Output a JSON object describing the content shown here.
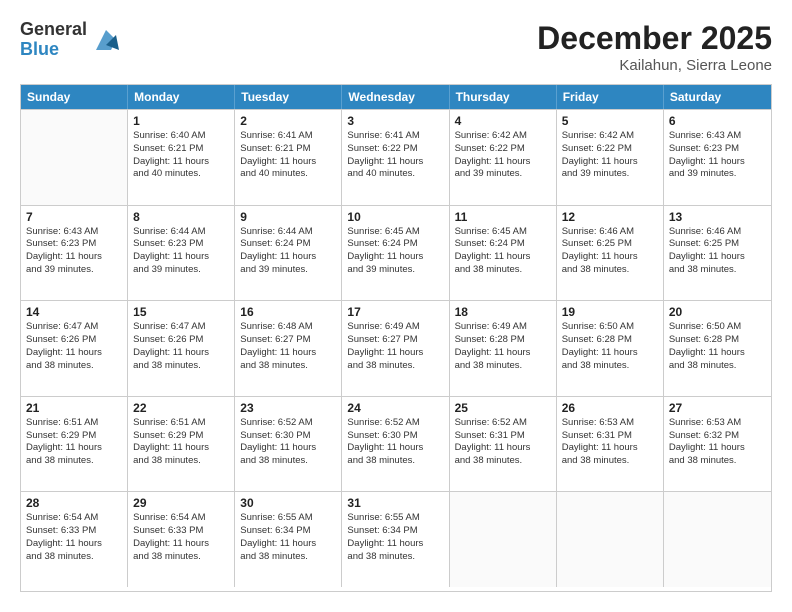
{
  "logo": {
    "general": "General",
    "blue": "Blue"
  },
  "title": "December 2025",
  "location": "Kailahun, Sierra Leone",
  "days_of_week": [
    "Sunday",
    "Monday",
    "Tuesday",
    "Wednesday",
    "Thursday",
    "Friday",
    "Saturday"
  ],
  "weeks": [
    [
      {
        "day": "",
        "sunrise": "",
        "sunset": "",
        "daylight": "",
        "empty": true
      },
      {
        "day": "1",
        "sunrise": "Sunrise: 6:40 AM",
        "sunset": "Sunset: 6:21 PM",
        "daylight": "Daylight: 11 hours and 40 minutes."
      },
      {
        "day": "2",
        "sunrise": "Sunrise: 6:41 AM",
        "sunset": "Sunset: 6:21 PM",
        "daylight": "Daylight: 11 hours and 40 minutes."
      },
      {
        "day": "3",
        "sunrise": "Sunrise: 6:41 AM",
        "sunset": "Sunset: 6:22 PM",
        "daylight": "Daylight: 11 hours and 40 minutes."
      },
      {
        "day": "4",
        "sunrise": "Sunrise: 6:42 AM",
        "sunset": "Sunset: 6:22 PM",
        "daylight": "Daylight: 11 hours and 39 minutes."
      },
      {
        "day": "5",
        "sunrise": "Sunrise: 6:42 AM",
        "sunset": "Sunset: 6:22 PM",
        "daylight": "Daylight: 11 hours and 39 minutes."
      },
      {
        "day": "6",
        "sunrise": "Sunrise: 6:43 AM",
        "sunset": "Sunset: 6:23 PM",
        "daylight": "Daylight: 11 hours and 39 minutes."
      }
    ],
    [
      {
        "day": "7",
        "sunrise": "Sunrise: 6:43 AM",
        "sunset": "Sunset: 6:23 PM",
        "daylight": "Daylight: 11 hours and 39 minutes."
      },
      {
        "day": "8",
        "sunrise": "Sunrise: 6:44 AM",
        "sunset": "Sunset: 6:23 PM",
        "daylight": "Daylight: 11 hours and 39 minutes."
      },
      {
        "day": "9",
        "sunrise": "Sunrise: 6:44 AM",
        "sunset": "Sunset: 6:24 PM",
        "daylight": "Daylight: 11 hours and 39 minutes."
      },
      {
        "day": "10",
        "sunrise": "Sunrise: 6:45 AM",
        "sunset": "Sunset: 6:24 PM",
        "daylight": "Daylight: 11 hours and 39 minutes."
      },
      {
        "day": "11",
        "sunrise": "Sunrise: 6:45 AM",
        "sunset": "Sunset: 6:24 PM",
        "daylight": "Daylight: 11 hours and 38 minutes."
      },
      {
        "day": "12",
        "sunrise": "Sunrise: 6:46 AM",
        "sunset": "Sunset: 6:25 PM",
        "daylight": "Daylight: 11 hours and 38 minutes."
      },
      {
        "day": "13",
        "sunrise": "Sunrise: 6:46 AM",
        "sunset": "Sunset: 6:25 PM",
        "daylight": "Daylight: 11 hours and 38 minutes."
      }
    ],
    [
      {
        "day": "14",
        "sunrise": "Sunrise: 6:47 AM",
        "sunset": "Sunset: 6:26 PM",
        "daylight": "Daylight: 11 hours and 38 minutes."
      },
      {
        "day": "15",
        "sunrise": "Sunrise: 6:47 AM",
        "sunset": "Sunset: 6:26 PM",
        "daylight": "Daylight: 11 hours and 38 minutes."
      },
      {
        "day": "16",
        "sunrise": "Sunrise: 6:48 AM",
        "sunset": "Sunset: 6:27 PM",
        "daylight": "Daylight: 11 hours and 38 minutes."
      },
      {
        "day": "17",
        "sunrise": "Sunrise: 6:49 AM",
        "sunset": "Sunset: 6:27 PM",
        "daylight": "Daylight: 11 hours and 38 minutes."
      },
      {
        "day": "18",
        "sunrise": "Sunrise: 6:49 AM",
        "sunset": "Sunset: 6:28 PM",
        "daylight": "Daylight: 11 hours and 38 minutes."
      },
      {
        "day": "19",
        "sunrise": "Sunrise: 6:50 AM",
        "sunset": "Sunset: 6:28 PM",
        "daylight": "Daylight: 11 hours and 38 minutes."
      },
      {
        "day": "20",
        "sunrise": "Sunrise: 6:50 AM",
        "sunset": "Sunset: 6:28 PM",
        "daylight": "Daylight: 11 hours and 38 minutes."
      }
    ],
    [
      {
        "day": "21",
        "sunrise": "Sunrise: 6:51 AM",
        "sunset": "Sunset: 6:29 PM",
        "daylight": "Daylight: 11 hours and 38 minutes."
      },
      {
        "day": "22",
        "sunrise": "Sunrise: 6:51 AM",
        "sunset": "Sunset: 6:29 PM",
        "daylight": "Daylight: 11 hours and 38 minutes."
      },
      {
        "day": "23",
        "sunrise": "Sunrise: 6:52 AM",
        "sunset": "Sunset: 6:30 PM",
        "daylight": "Daylight: 11 hours and 38 minutes."
      },
      {
        "day": "24",
        "sunrise": "Sunrise: 6:52 AM",
        "sunset": "Sunset: 6:30 PM",
        "daylight": "Daylight: 11 hours and 38 minutes."
      },
      {
        "day": "25",
        "sunrise": "Sunrise: 6:52 AM",
        "sunset": "Sunset: 6:31 PM",
        "daylight": "Daylight: 11 hours and 38 minutes."
      },
      {
        "day": "26",
        "sunrise": "Sunrise: 6:53 AM",
        "sunset": "Sunset: 6:31 PM",
        "daylight": "Daylight: 11 hours and 38 minutes."
      },
      {
        "day": "27",
        "sunrise": "Sunrise: 6:53 AM",
        "sunset": "Sunset: 6:32 PM",
        "daylight": "Daylight: 11 hours and 38 minutes."
      }
    ],
    [
      {
        "day": "28",
        "sunrise": "Sunrise: 6:54 AM",
        "sunset": "Sunset: 6:33 PM",
        "daylight": "Daylight: 11 hours and 38 minutes."
      },
      {
        "day": "29",
        "sunrise": "Sunrise: 6:54 AM",
        "sunset": "Sunset: 6:33 PM",
        "daylight": "Daylight: 11 hours and 38 minutes."
      },
      {
        "day": "30",
        "sunrise": "Sunrise: 6:55 AM",
        "sunset": "Sunset: 6:34 PM",
        "daylight": "Daylight: 11 hours and 38 minutes."
      },
      {
        "day": "31",
        "sunrise": "Sunrise: 6:55 AM",
        "sunset": "Sunset: 6:34 PM",
        "daylight": "Daylight: 11 hours and 38 minutes."
      },
      {
        "day": "",
        "sunrise": "",
        "sunset": "",
        "daylight": "",
        "empty": true
      },
      {
        "day": "",
        "sunrise": "",
        "sunset": "",
        "daylight": "",
        "empty": true
      },
      {
        "day": "",
        "sunrise": "",
        "sunset": "",
        "daylight": "",
        "empty": true
      }
    ]
  ]
}
